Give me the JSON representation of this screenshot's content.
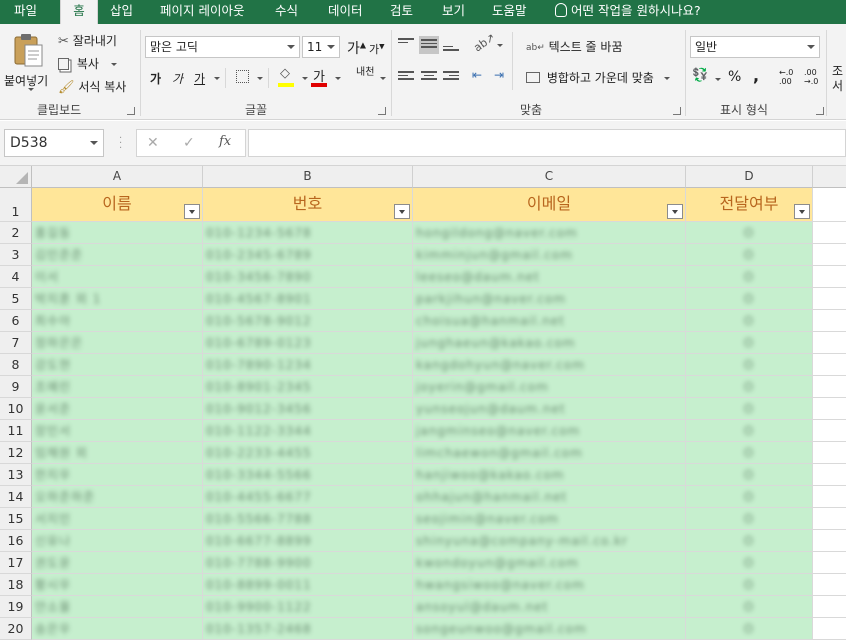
{
  "ribbon_tabs": [
    "파일",
    "홈",
    "삽입",
    "페이지 레이아웃",
    "수식",
    "데이터",
    "검토",
    "보기",
    "도움말",
    "어떤 작업을 원하시나요?"
  ],
  "active_tab": "홈",
  "clipboard": {
    "paste": "붙여넣기",
    "cut": "잘라내기",
    "copy": "복사",
    "format_painter": "서식 복사",
    "group": "클립보드"
  },
  "font": {
    "name": "맑은 고딕",
    "size": "11",
    "group": "글꼴",
    "bold": "가",
    "italic": "가",
    "underline": "가",
    "grow": "가",
    "shrink": "가",
    "color_letter": "가",
    "phonetic": "내천"
  },
  "alignment": {
    "wrap_text": "텍스트 줄 바꿈",
    "merge_center": "병합하고 가운데 맞춤",
    "group": "맞춤"
  },
  "number": {
    "format": "일반",
    "group": "표시 형식",
    "percent": "%",
    "comma": ",",
    "inc_decimal": "←.0\n.00",
    "dec_decimal": ".00\n→.0"
  },
  "styles_partial": "조\n서",
  "formula_bar": {
    "name_box": "D538",
    "fx": "fx",
    "cancel": "✕",
    "enter": "✓",
    "formula": ""
  },
  "columns": [
    "A",
    "B",
    "C",
    "D"
  ],
  "table": {
    "headers": [
      "이름",
      "번호",
      "이메일",
      "전달여부"
    ],
    "rows": [
      {
        "row": "2",
        "name": "홍길동",
        "phone": "010-1234-5678",
        "email": "hongildong@naver.com",
        "status": "O"
      },
      {
        "row": "3",
        "name": "김민준준",
        "phone": "010-2345-6789",
        "email": "kimminjun@gmail.com",
        "status": "O"
      },
      {
        "row": "4",
        "name": "이서",
        "phone": "010-3456-7890",
        "email": "leeseo@daum.net",
        "status": "O"
      },
      {
        "row": "5",
        "name": "박지훈 외 1",
        "phone": "010-4567-8901",
        "email": "parkjihun@naver.com",
        "status": "O"
      },
      {
        "row": "6",
        "name": "최수아",
        "phone": "010-5678-9012",
        "email": "choisua@hanmail.net",
        "status": "O"
      },
      {
        "row": "7",
        "name": "정하은은",
        "phone": "010-6789-0123",
        "email": "junghaeun@kakao.com",
        "status": "O"
      },
      {
        "row": "8",
        "name": "강도현",
        "phone": "010-7890-1234",
        "email": "kangdohyun@naver.com",
        "status": "O"
      },
      {
        "row": "9",
        "name": "조예린",
        "phone": "010-8901-2345",
        "email": "joyerin@gmail.com",
        "status": "O"
      },
      {
        "row": "10",
        "name": "윤서준",
        "phone": "010-9012-3456",
        "email": "yunseojun@daum.net",
        "status": "O"
      },
      {
        "row": "11",
        "name": "장민서",
        "phone": "010-1122-3344",
        "email": "jangminseo@naver.com",
        "status": "O"
      },
      {
        "row": "12",
        "name": "임채원 외",
        "phone": "010-2233-4455",
        "email": "limchaewon@gmail.com",
        "status": "O"
      },
      {
        "row": "13",
        "name": "한지우",
        "phone": "010-3344-5566",
        "email": "hanjiwoo@kakao.com",
        "status": "O"
      },
      {
        "row": "14",
        "name": "오하준하준",
        "phone": "010-4455-6677",
        "email": "ohhajun@hanmail.net",
        "status": "O"
      },
      {
        "row": "15",
        "name": "서지민",
        "phone": "010-5566-7788",
        "email": "seojimin@naver.com",
        "status": "O"
      },
      {
        "row": "16",
        "name": "신유나",
        "phone": "010-6677-8899",
        "email": "shinyuna@company-mail.co.kr",
        "status": "O"
      },
      {
        "row": "17",
        "name": "권도윤",
        "phone": "010-7788-9900",
        "email": "kwondoyun@gmail.com",
        "status": "O"
      },
      {
        "row": "18",
        "name": "황시우",
        "phone": "010-8899-0011",
        "email": "hwangsiwoo@naver.com",
        "status": "O"
      },
      {
        "row": "19",
        "name": "안소율",
        "phone": "010-9900-1122",
        "email": "ansoyul@daum.net",
        "status": "O"
      },
      {
        "row": "20",
        "name": "송은우",
        "phone": "010-1357-2468",
        "email": "songeunwoo@gmail.com",
        "status": "O"
      }
    ]
  },
  "colors": {
    "excel_green": "#217346",
    "header_fill": "#ffe699",
    "header_text": "#b8661e",
    "row_fill": "#c6efce"
  }
}
